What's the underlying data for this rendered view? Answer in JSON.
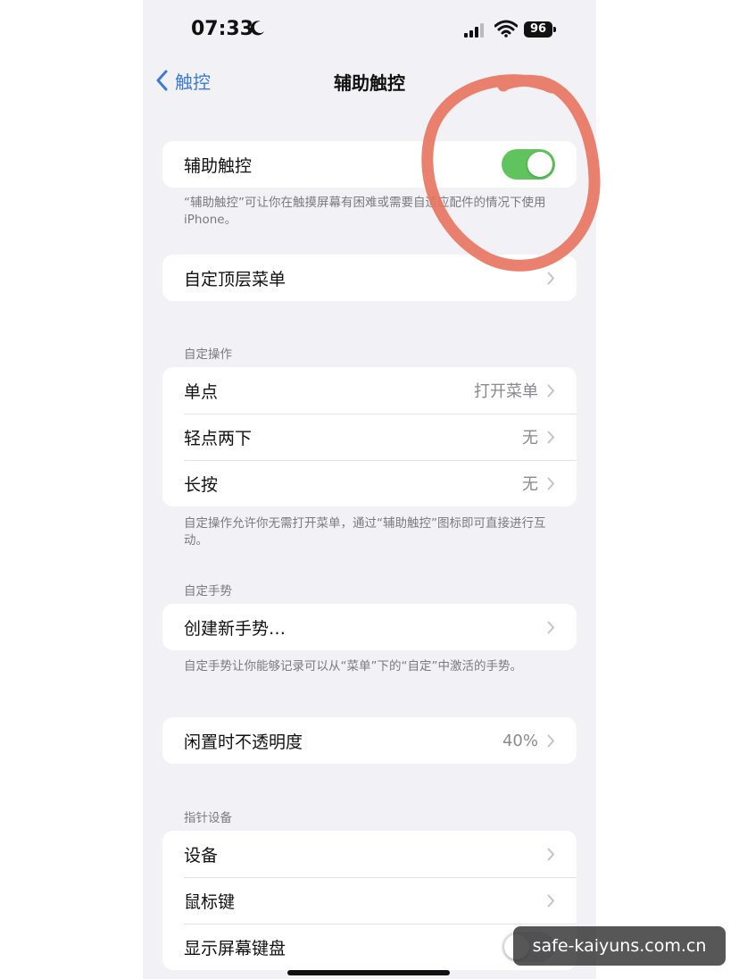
{
  "status_bar": {
    "time": "07:33",
    "battery": "96"
  },
  "nav": {
    "back_label": "触控",
    "title": "辅助触控"
  },
  "assistive_touch": {
    "label": "辅助触控",
    "enabled": true,
    "footnote": "“辅助触控”可让你在触摸屏幕有困难或需要自适应配件的情况下使用iPhone。"
  },
  "customize_menu": {
    "label": "自定顶层菜单"
  },
  "custom_actions": {
    "header": "自定操作",
    "rows": [
      {
        "label": "单点",
        "value": "打开菜单"
      },
      {
        "label": "轻点两下",
        "value": "无"
      },
      {
        "label": "长按",
        "value": "无"
      }
    ],
    "footnote": "自定操作允许你无需打开菜单，通过“辅助触控”图标即可直接进行互动。"
  },
  "custom_gestures": {
    "header": "自定手势",
    "create_label": "创建新手势…",
    "footnote": "自定手势让你能够记录可以从“菜单”下的“自定”中激活的手势。"
  },
  "idle_opacity": {
    "label": "闲置时不透明度",
    "value": "40%"
  },
  "pointer_devices": {
    "header": "指针设备",
    "rows": [
      {
        "label": "设备"
      },
      {
        "label": "鼠标键"
      },
      {
        "label": "显示屏幕键盘"
      }
    ]
  },
  "watermark": "safe-kaiyuns.com.cn",
  "colors": {
    "accent": "#3b7bd6",
    "toggle_on": "#5fc45d",
    "annotation": "#e8735f"
  }
}
